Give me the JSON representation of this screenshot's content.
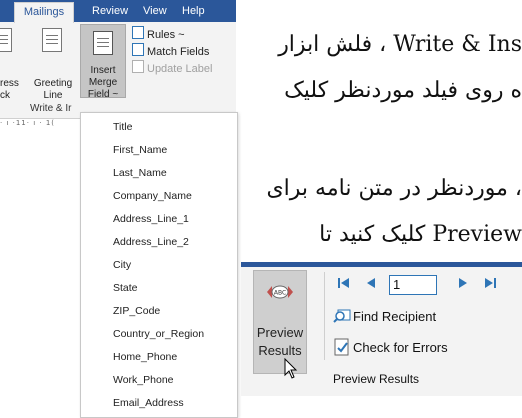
{
  "ribbon": {
    "tabs": [
      "Mailings",
      "Review",
      "View",
      "Help"
    ],
    "left_buttons": {
      "address_label": "ress",
      "address_label2": "ck",
      "greeting_label": "Greeting",
      "greeting_label2": "Line"
    },
    "insert_merge": {
      "label": "Insert Merge",
      "label2": "Field",
      "chevron": "~"
    },
    "rules": "Rules ~",
    "match_fields": "Match Fields",
    "update_labels": "Update Label",
    "group_label": "Write & Ir",
    "ruler": "· ı ·11· ı · 1("
  },
  "merge_fields": [
    "Title",
    "First_Name",
    "Last_Name",
    "Company_Name",
    "Address_Line_1",
    "Address_Line_2",
    "City",
    "State",
    "ZIP_Code",
    "Country_or_Region",
    "Home_Phone",
    "Work_Phone",
    "Email_Address"
  ],
  "text_lines": {
    "l1": "Write & Ins ، فلش ابزار",
    "l2": "ه روی فیلد موردنظر کلیک",
    "l3": "، موردنظر در متن نامه برای",
    "l4": "Preview کلیک کنید تا"
  },
  "preview": {
    "preview_label1": "Preview",
    "preview_label2": "Results",
    "record_number": "1",
    "find_recipient": "Find Recipient",
    "check_errors": "Check for Errors",
    "group_name": "Preview Results",
    "icons": [
      "first-record-icon",
      "previous-record-icon",
      "next-record-icon",
      "last-record-icon",
      "find-icon",
      "check-errors-icon",
      "abc-preview-icon"
    ]
  },
  "colors": {
    "ribbon_blue": "#2b579a",
    "accent": "#2e75b6",
    "ribbon_bg": "#f3f3f3"
  }
}
